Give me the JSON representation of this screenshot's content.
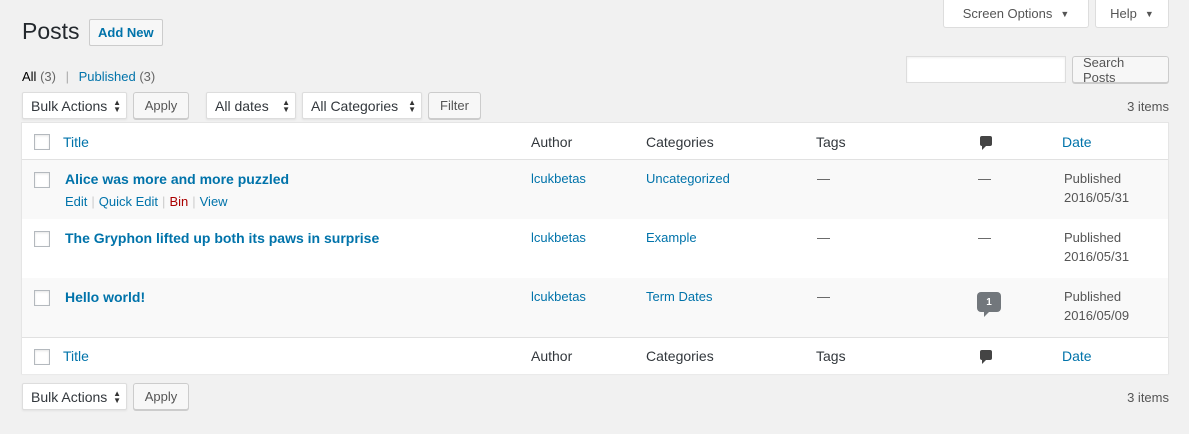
{
  "screen_meta": {
    "screen_options": "Screen Options",
    "help": "Help"
  },
  "page": {
    "title": "Posts",
    "add_new": "Add New"
  },
  "views": {
    "all": "All",
    "all_count": "(3)",
    "sep": "|",
    "published": "Published",
    "published_count": "(3)"
  },
  "search": {
    "value": "",
    "button": "Search Posts"
  },
  "top_nav": {
    "bulk_actions": "Bulk Actions",
    "apply": "Apply",
    "dates": "All dates",
    "categories": "All Categories",
    "filter": "Filter",
    "items": "3 items"
  },
  "bottom_nav": {
    "bulk_actions": "Bulk Actions",
    "apply": "Apply",
    "items": "3 items"
  },
  "columns": {
    "title": "Title",
    "author": "Author",
    "categories": "Categories",
    "tags": "Tags",
    "date": "Date"
  },
  "row_actions": {
    "edit": "Edit",
    "quick_edit": "Quick Edit",
    "bin": "Bin",
    "view": "View",
    "sep": "|"
  },
  "posts": [
    {
      "title": "Alice was more and more puzzled",
      "author": "lcukbetas",
      "category": "Uncategorized",
      "tags": "—",
      "comments": "—",
      "status": "Published",
      "date": "2016/05/31"
    },
    {
      "title": "The Gryphon lifted up both its paws in surprise",
      "author": "lcukbetas",
      "category": "Example",
      "tags": "—",
      "comments": "—",
      "status": "Published",
      "date": "2016/05/31"
    },
    {
      "title": "Hello world!",
      "author": "lcukbetas",
      "category": "Term Dates",
      "tags": "—",
      "comments": "1",
      "status": "Published",
      "date": "2016/05/09"
    }
  ],
  "icons": {
    "dropdown": "caret-down-icon",
    "select": "updown-arrows-icon",
    "comments": "comment-bubble-icon"
  },
  "colors": {
    "link": "#0073aa",
    "trash": "#a00",
    "background": "#f1f1f1"
  }
}
